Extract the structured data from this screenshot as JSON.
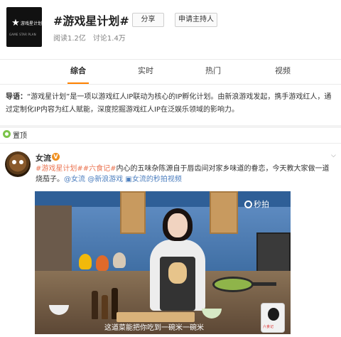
{
  "header": {
    "logo_text": "游戏星计划",
    "logo_subtext": "GAME STAR PLAN",
    "title": "#游戏星计划#",
    "share_label": "分享",
    "apply_host_label": "申请主持人",
    "reads": "阅读1.2亿",
    "discussions": "讨论1.4万"
  },
  "tabs": [
    {
      "label": "综合",
      "active": true
    },
    {
      "label": "实时",
      "active": false
    },
    {
      "label": "热门",
      "active": false
    },
    {
      "label": "视频",
      "active": false
    }
  ],
  "intro": {
    "lead": "导语：",
    "text": "“游戏星计划”是一项以游戏红人IP联动为核心的IP孵化计划。由新浪游戏发起，携手游戏红人，通过定制化IP内容为红人赋能，深度挖掘游戏红人IP在泛娱乐领域的影响力。"
  },
  "pinned": {
    "label": "置顶"
  },
  "post": {
    "author": "女流",
    "verified_badge": "V",
    "tag1": "#游戏星计划#",
    "tag2": "#六食记#",
    "body": "内心的五味杂陈源自于唇齿间对家乡味道的眷恋，今天教大家做一道烧茄子。",
    "mention1": "@女流",
    "mention2": "@新浪游戏",
    "video_link": "女流的秒拍视频",
    "video": {
      "watermark": "秒拍",
      "subtitle": "这道菜能把你吃到一碗米一碗米",
      "badge_text": "六食记"
    }
  },
  "colors": {
    "accent": "#ff8200",
    "tag": "#eb7350",
    "link": "#4d7fbf"
  }
}
